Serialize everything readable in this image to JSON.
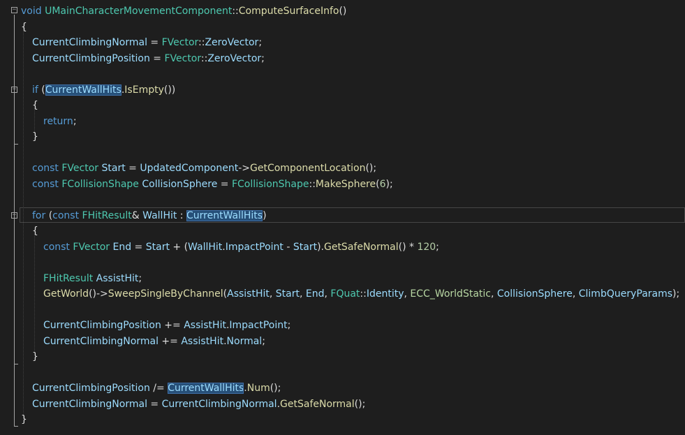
{
  "editor": {
    "colors": {
      "background": "#1e1e1e",
      "keyword": "#569cd6",
      "type": "#4ec9b0",
      "function": "#dcdcaa",
      "variable": "#9cdcfe",
      "text": "#dcdcdc",
      "number": "#b5cea8",
      "macro": "#bd63c5",
      "enum": "#b8d7a3",
      "selection": "#264f78"
    },
    "lines": [
      {
        "indent": 0,
        "tokens": [
          [
            "kw",
            "void"
          ],
          [
            "pl",
            " "
          ],
          [
            "ty",
            "UMainCharacterMovementComponent"
          ],
          [
            "op",
            "::"
          ],
          [
            "fn",
            "ComputeSurfaceInfo"
          ],
          [
            "pl",
            "()"
          ]
        ]
      },
      {
        "indent": 0,
        "tokens": [
          [
            "pl",
            "{"
          ]
        ]
      },
      {
        "indent": 1,
        "tokens": [
          [
            "va",
            "CurrentClimbingNormal"
          ],
          [
            "pl",
            " = "
          ],
          [
            "ty",
            "FVector"
          ],
          [
            "op",
            "::"
          ],
          [
            "va",
            "ZeroVector"
          ],
          [
            "pl",
            ";"
          ]
        ]
      },
      {
        "indent": 1,
        "tokens": [
          [
            "va",
            "CurrentClimbingPosition"
          ],
          [
            "pl",
            " = "
          ],
          [
            "ty",
            "FVector"
          ],
          [
            "op",
            "::"
          ],
          [
            "va",
            "ZeroVector"
          ],
          [
            "pl",
            ";"
          ]
        ]
      },
      {
        "indent": 1,
        "tokens": []
      },
      {
        "indent": 1,
        "tokens": [
          [
            "kw",
            "if"
          ],
          [
            "pl",
            " ("
          ],
          [
            "vah",
            "CurrentWallHits"
          ],
          [
            "pl",
            "."
          ],
          [
            "fn",
            "IsEmpty"
          ],
          [
            "pl",
            "())"
          ]
        ]
      },
      {
        "indent": 1,
        "tokens": [
          [
            "pl",
            "{"
          ]
        ]
      },
      {
        "indent": 2,
        "tokens": [
          [
            "kw",
            "return"
          ],
          [
            "pl",
            ";"
          ]
        ]
      },
      {
        "indent": 1,
        "tokens": [
          [
            "pl",
            "}"
          ]
        ]
      },
      {
        "indent": 1,
        "tokens": []
      },
      {
        "indent": 1,
        "tokens": [
          [
            "kw",
            "const"
          ],
          [
            "pl",
            " "
          ],
          [
            "ty",
            "FVector"
          ],
          [
            "pl",
            " "
          ],
          [
            "va",
            "Start"
          ],
          [
            "pl",
            " = "
          ],
          [
            "va",
            "UpdatedComponent"
          ],
          [
            "pl",
            "->"
          ],
          [
            "fn",
            "GetComponentLocation"
          ],
          [
            "pl",
            "();"
          ]
        ]
      },
      {
        "indent": 1,
        "tokens": [
          [
            "kw",
            "const"
          ],
          [
            "pl",
            " "
          ],
          [
            "ty",
            "FCollisionShape"
          ],
          [
            "pl",
            " "
          ],
          [
            "va",
            "CollisionSphere"
          ],
          [
            "pl",
            " = "
          ],
          [
            "ty",
            "FCollisionShape"
          ],
          [
            "op",
            "::"
          ],
          [
            "fn",
            "MakeSphere"
          ],
          [
            "pl",
            "("
          ],
          [
            "nu",
            "6"
          ],
          [
            "pl",
            ");"
          ]
        ]
      },
      {
        "indent": 1,
        "tokens": []
      },
      {
        "indent": 1,
        "tokens": [
          [
            "kw",
            "for"
          ],
          [
            "pl",
            " ("
          ],
          [
            "kw",
            "const"
          ],
          [
            "pl",
            " "
          ],
          [
            "ty",
            "FHitResult"
          ],
          [
            "pl",
            "& "
          ],
          [
            "va",
            "WallHit"
          ],
          [
            "pl",
            " : "
          ],
          [
            "vah",
            "CurrentWallHits"
          ],
          [
            "pl",
            ")"
          ]
        ]
      },
      {
        "indent": 1,
        "tokens": [
          [
            "pl",
            "{"
          ]
        ]
      },
      {
        "indent": 2,
        "tokens": [
          [
            "kw",
            "const"
          ],
          [
            "pl",
            " "
          ],
          [
            "ty",
            "FVector"
          ],
          [
            "pl",
            " "
          ],
          [
            "va",
            "End"
          ],
          [
            "pl",
            " = "
          ],
          [
            "va",
            "Start"
          ],
          [
            "pl",
            " + ("
          ],
          [
            "va",
            "WallHit"
          ],
          [
            "pl",
            "."
          ],
          [
            "va",
            "ImpactPoint"
          ],
          [
            "pl",
            " - "
          ],
          [
            "va",
            "Start"
          ],
          [
            "pl",
            ")."
          ],
          [
            "fn",
            "GetSafeNormal"
          ],
          [
            "pl",
            "() * "
          ],
          [
            "nu",
            "120"
          ],
          [
            "pl",
            ";"
          ]
        ]
      },
      {
        "indent": 2,
        "tokens": []
      },
      {
        "indent": 2,
        "tokens": [
          [
            "ty",
            "FHitResult"
          ],
          [
            "pl",
            " "
          ],
          [
            "va",
            "AssistHit"
          ],
          [
            "pl",
            ";"
          ]
        ]
      },
      {
        "indent": 2,
        "tokens": [
          [
            "fn",
            "GetWorld"
          ],
          [
            "pl",
            "()->"
          ],
          [
            "fn",
            "SweepSingleByChannel"
          ],
          [
            "pl",
            "("
          ],
          [
            "va",
            "AssistHit"
          ],
          [
            "pl",
            ", "
          ],
          [
            "va",
            "Start"
          ],
          [
            "pl",
            ", "
          ],
          [
            "va",
            "End"
          ],
          [
            "pl",
            ", "
          ],
          [
            "ty",
            "FQuat"
          ],
          [
            "op",
            "::"
          ],
          [
            "va",
            "Identity"
          ],
          [
            "pl",
            ", "
          ],
          [
            "en",
            "ECC_WorldStatic"
          ],
          [
            "pl",
            ", "
          ],
          [
            "va",
            "CollisionSphere"
          ],
          [
            "pl",
            ", "
          ],
          [
            "va",
            "ClimbQueryParams"
          ],
          [
            "pl",
            ");"
          ]
        ]
      },
      {
        "indent": 2,
        "tokens": []
      },
      {
        "indent": 2,
        "tokens": [
          [
            "va",
            "CurrentClimbingPosition"
          ],
          [
            "pl",
            " += "
          ],
          [
            "va",
            "AssistHit"
          ],
          [
            "pl",
            "."
          ],
          [
            "va",
            "ImpactPoint"
          ],
          [
            "pl",
            ";"
          ]
        ]
      },
      {
        "indent": 2,
        "tokens": [
          [
            "va",
            "CurrentClimbingNormal"
          ],
          [
            "pl",
            " += "
          ],
          [
            "va",
            "AssistHit"
          ],
          [
            "pl",
            "."
          ],
          [
            "va",
            "Normal"
          ],
          [
            "pl",
            ";"
          ]
        ]
      },
      {
        "indent": 1,
        "tokens": [
          [
            "pl",
            "}"
          ]
        ]
      },
      {
        "indent": 1,
        "tokens": []
      },
      {
        "indent": 1,
        "tokens": [
          [
            "va",
            "CurrentClimbingPosition"
          ],
          [
            "pl",
            " /= "
          ],
          [
            "vah",
            "CurrentWallHits"
          ],
          [
            "pl",
            "."
          ],
          [
            "fn",
            "Num"
          ],
          [
            "pl",
            "();"
          ]
        ]
      },
      {
        "indent": 1,
        "tokens": [
          [
            "va",
            "CurrentClimbingNormal"
          ],
          [
            "pl",
            " = "
          ],
          [
            "va",
            "CurrentClimbingNormal"
          ],
          [
            "pl",
            "."
          ],
          [
            "fn",
            "GetSafeNormal"
          ],
          [
            "pl",
            "();"
          ]
        ]
      },
      {
        "indent": 0,
        "tokens": [
          [
            "pl",
            "}"
          ]
        ]
      }
    ]
  }
}
